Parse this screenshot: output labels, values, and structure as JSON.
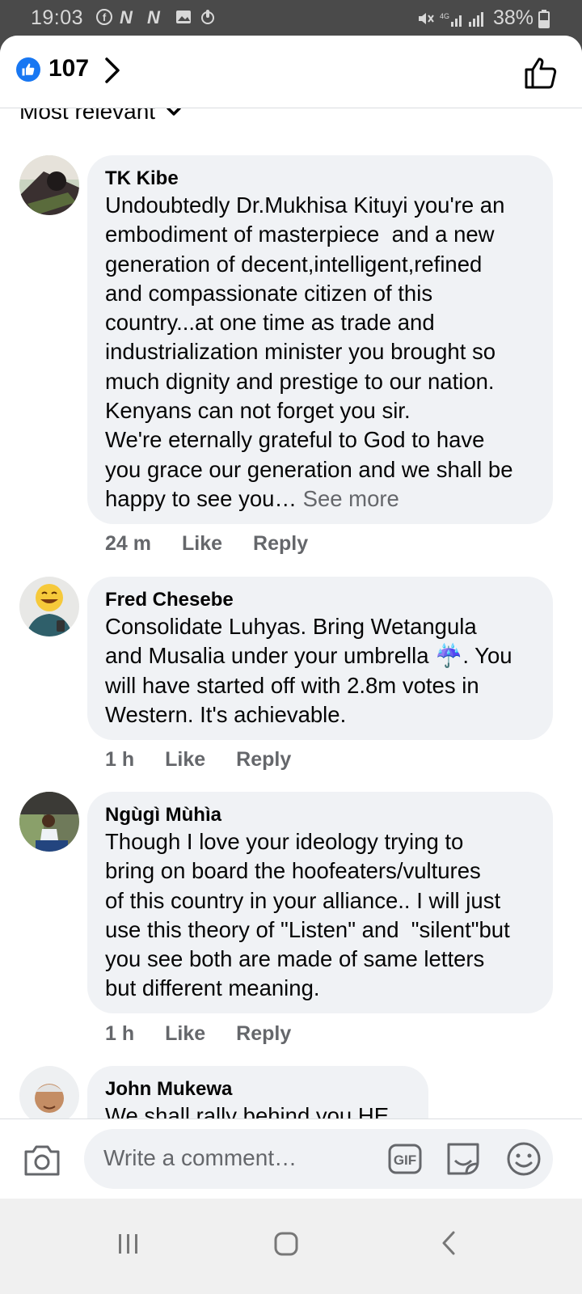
{
  "status_bar": {
    "time": "19:03",
    "battery": "38%"
  },
  "reactions": {
    "count": "107"
  },
  "sort": {
    "label": "Most relevant"
  },
  "comments": [
    {
      "author": "TK Kibe",
      "text": "Undoubtedly Dr.Mukhisa Kituyi you're an\nembodiment of masterpiece  and a new\ngeneration of decent,intelligent,refined\nand compassionate citizen of this\ncountry...at one time as trade and\nindustrialization minister you brought so\nmuch dignity and prestige to our nation.\nKenyans can not forget you sir.\nWe're eternally grateful to God to have\nyou grace our generation and we shall be\nhappy to see you… ",
      "see_more": "See more",
      "time": "24 m",
      "like": "Like",
      "reply": "Reply"
    },
    {
      "author": "Fred Chesebe",
      "text": "Consolidate Luhyas. Bring Wetangula\nand Musalia under your umbrella ☔. You\nwill have started off with 2.8m votes in\nWestern. It's achievable.",
      "time": "1 h",
      "like": "Like",
      "reply": "Reply"
    },
    {
      "author": "Ngùgì Mùhìa",
      "text": "Though I love your ideology trying to\nbring on board the hoofeaters/vultures\nof this country in your alliance.. I will just\nuse this theory of \"Listen\" and  \"silent\"but\nyou see both are made of same letters\nbut different meaning.",
      "time": "1 h",
      "like": "Like",
      "reply": "Reply"
    },
    {
      "author": "John Mukewa",
      "text": "We shall rally behind you HE"
    }
  ],
  "composer": {
    "placeholder": "Write a comment…",
    "gif_label": "GIF"
  },
  "colors": {
    "brand": "#1877f2",
    "bubble": "#f0f2f5",
    "secondary_text": "#65676b"
  }
}
